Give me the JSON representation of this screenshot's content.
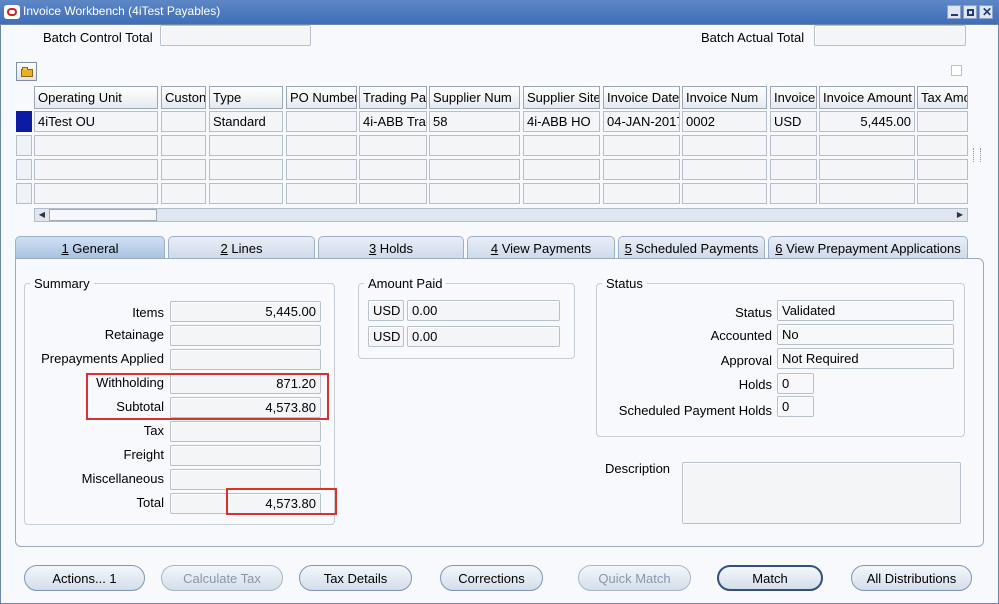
{
  "window": {
    "title": "Invoice Workbench (4iTest Payables)"
  },
  "header": {
    "batch_control_total_label": "Batch Control Total",
    "batch_control_total_value": "",
    "batch_actual_total_label": "Batch Actual Total",
    "batch_actual_total_value": ""
  },
  "grid": {
    "columns": [
      "Operating Unit",
      "Custon",
      "Type",
      "PO Number",
      "Trading Pa",
      "Supplier Num",
      "Supplier Site",
      "Invoice Date",
      "Invoice Num",
      "Invoice",
      "Invoice Amount",
      "Tax Amo"
    ],
    "rows": [
      [
        "4iTest OU",
        "",
        "Standard",
        "",
        "4i-ABB Tra",
        "58",
        "4i-ABB HO",
        "04-JAN-2017",
        "0002",
        "USD",
        "5,445.00",
        ""
      ]
    ]
  },
  "tabs": [
    {
      "key": "1",
      "label": " General"
    },
    {
      "key": "2",
      "label": " Lines"
    },
    {
      "key": "3",
      "label": " Holds"
    },
    {
      "key": "4",
      "label": " View Payments"
    },
    {
      "key": "5",
      "label": " Scheduled Payments"
    },
    {
      "key": "6",
      "label": " View Prepayment Applications"
    }
  ],
  "summary": {
    "title": "Summary",
    "items_label": "Items",
    "items_value": "5,445.00",
    "retainage_label": "Retainage",
    "retainage_value": "",
    "prepayments_label": "Prepayments Applied",
    "prepayments_value": "",
    "withholding_label": "Withholding",
    "withholding_value": "871.20",
    "subtotal_label": "Subtotal",
    "subtotal_value": "4,573.80",
    "tax_label": "Tax",
    "tax_value": "",
    "freight_label": "Freight",
    "freight_value": "",
    "misc_label": "Miscellaneous",
    "misc_value": "",
    "total_label": "Total",
    "total_value": "4,573.80"
  },
  "amount_paid": {
    "title": "Amount Paid",
    "rows": [
      {
        "currency": "USD",
        "amount": "0.00"
      },
      {
        "currency": "USD",
        "amount": "0.00"
      }
    ]
  },
  "status": {
    "title": "Status",
    "status_label": "Status",
    "status_value": "Validated",
    "accounted_label": "Accounted",
    "accounted_value": "No",
    "approval_label": "Approval",
    "approval_value": "Not Required",
    "holds_label": "Holds",
    "holds_value": "0",
    "sched_holds_label": "Scheduled Payment Holds",
    "sched_holds_value": "0"
  },
  "description": {
    "label": "Description",
    "value": ""
  },
  "buttons": {
    "actions": "Actions... 1",
    "calculate_tax": "Calculate Tax",
    "tax_details": "Tax Details",
    "corrections": "Corrections",
    "quick_match": "Quick Match",
    "match": "Match",
    "all_distributions": "All Distributions"
  },
  "colors": {
    "highlight_box": "#d7332c",
    "selected_row": "#0c1ba1",
    "titlebar": "#3f6fb7"
  }
}
